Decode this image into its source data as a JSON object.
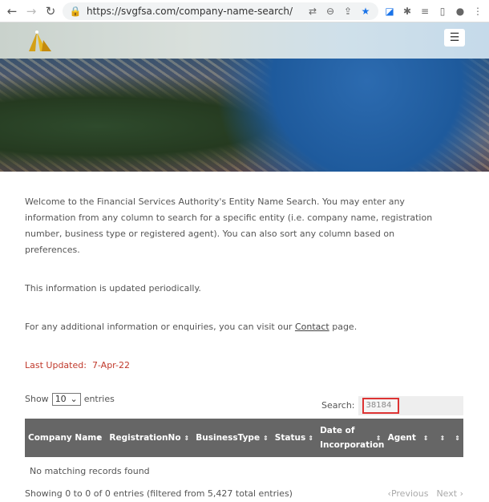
{
  "browser": {
    "url": "https://svgfsa.com/company-name-search/"
  },
  "intro": {
    "p1": "Welcome to the Financial Services Authority's Entity Name Search. You may enter any information from any column to search for a specific entity (i.e. company name, registration number, business type or registered agent). You can also sort any column based on preferences.",
    "p2": "This information is updated periodically.",
    "p3_before": "For any additional information or enquiries, you can visit our ",
    "p3_link": "Contact",
    "p3_after": " page.",
    "last_updated_label": "Last Updated:",
    "last_updated_value": "7-Apr-22"
  },
  "table_controls": {
    "show_label": "Show",
    "entries_value": "10",
    "entries_label": "entries",
    "search_label": "Search:",
    "search_value": "38184"
  },
  "table": {
    "columns": [
      "Company Name",
      "RegistrationNo",
      "BusinessType",
      "Status",
      "Date of Incorporation",
      "Agent",
      "",
      ""
    ],
    "empty_message": "No matching records found"
  },
  "footer": {
    "info": "Showing 0 to 0 of 0 entries (filtered from 5,427 total entries)",
    "previous": "Previous",
    "next": "Next"
  },
  "colors": {
    "header_bg": "#666666",
    "accent_red": "#c0392b",
    "search_border": "#dd3333"
  }
}
